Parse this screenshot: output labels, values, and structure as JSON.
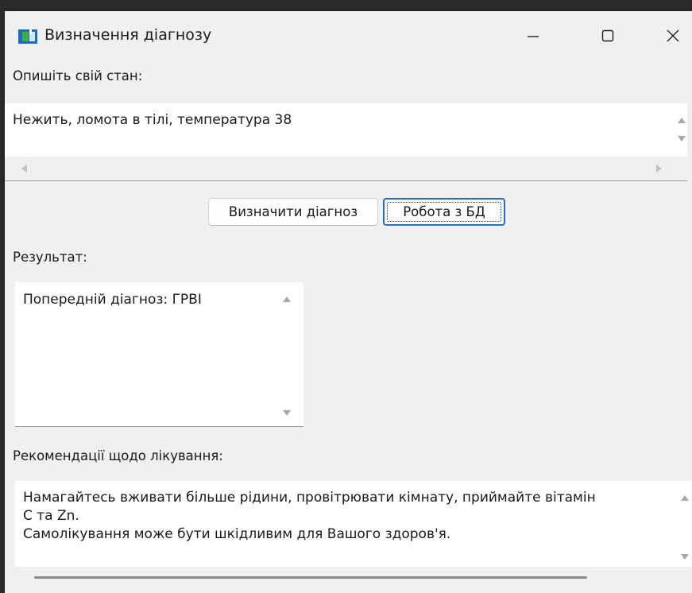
{
  "window": {
    "title": "Визначення діагнозу"
  },
  "titlebar_buttons": {
    "minimize": "minimize-icon",
    "maximize": "maximize-icon",
    "close": "close-icon"
  },
  "symptoms": {
    "label": "Опишіть свій стан:",
    "value": "Нежить, ломота в тілі, температура 38"
  },
  "buttons": {
    "diagnose": "Визначити діагноз",
    "database": "Робота з БД"
  },
  "result": {
    "label": "Результат:",
    "value": "Попередній діагноз: ГРВІ"
  },
  "recommendations": {
    "label": "Рекомендації щодо лікування:",
    "value": "Намагайтесь вживати більше рідини, провітрювати кімнату, приймайте вітамін\nC та Zn.\nСамолікування може бути шкідливим для Вашого здоров'я."
  },
  "colors": {
    "window_bg": "#f0f0f0",
    "textbox_bg": "#ffffff",
    "focus_border": "#1f6fbf"
  }
}
